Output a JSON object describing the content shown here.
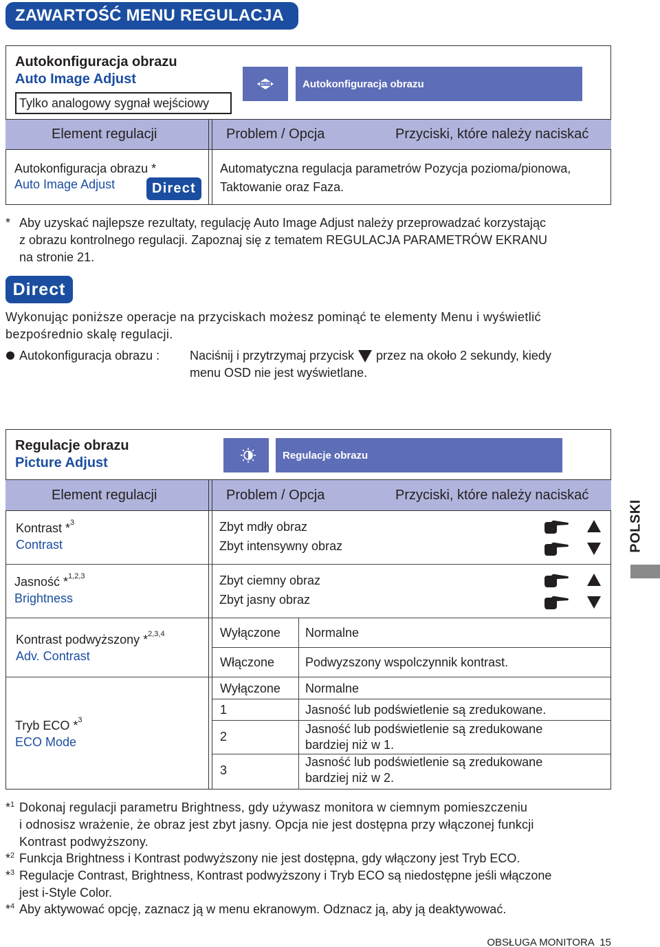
{
  "page_title": "ZAWARTOŚĆ MENU REGULACJA",
  "side_tab": "POLSKI",
  "footer": "OBSŁUGA MONITORA  15",
  "colors": {
    "brand_blue": "#1b4ea0",
    "osd_blue": "#5d6db7",
    "header_lavender": "#b0b4dc",
    "side_tab_grey": "#8a8a8a"
  },
  "auto_section": {
    "title": "Autokonfiguracja obrazu",
    "subtitle": "Auto Image Adjust",
    "note_box": "Tylko analogowy sygnał wejściowy",
    "osd_icon": "auto-adjust-icon",
    "osd_label": "Autokonfiguracja obrazu",
    "headers": {
      "element": "Element regulacji",
      "problem": "Problem / Opcja",
      "buttons": "Przyciski, które należy naciskać"
    },
    "row": {
      "name": "Autokonfiguracja obrazu *",
      "name_en": "Auto Image Adjust",
      "badge": "Direct",
      "desc_line1": "Automatyczna regulacja parametrów Pozycja pozioma/pionowa,",
      "desc_line2": "Taktowanie oraz Faza."
    },
    "footnote": {
      "marker": "*",
      "line1": "Aby uzyskać najlepsze rezultaty, regulację Auto Image Adjust należy przeprowadzać korzystając",
      "line2": "z obrazu kontrolnego regulacji. Zapoznaj się z tematem REGULACJA PARAMETRÓW EKRANU",
      "line3": "na stronie 21."
    }
  },
  "direct_section": {
    "badge": "Direct",
    "intro_line1": "Wykonując poniższe operacje na przyciskach możesz pominąć te elementy Menu i wyświetlić",
    "intro_line2": "bezpośrednio skalę regulacji.",
    "item_label": "Autokonfiguracja obrazu :",
    "item_text_before": "Naciśnij i przytrzymaj przycisk",
    "item_button_icon": "down-triangle-icon",
    "item_text_after": "przez na około 2 sekundy, kiedy",
    "item_text_line2": "menu OSD nie jest wyświetlane."
  },
  "picture_section": {
    "title": "Regulacje obrazu",
    "subtitle": "Picture Adjust",
    "osd_icon": "brightness-contrast-icon",
    "osd_label": "Regulacje obrazu",
    "headers": {
      "element": "Element regulacji",
      "problem": "Problem / Opcja",
      "buttons": "Przyciski, które należy naciskać"
    },
    "contrast": {
      "name": "Kontrast *",
      "sup": "3",
      "name_en": "Contrast",
      "problems": [
        "Zbyt mdły obraz",
        "Zbyt intensywny obraz"
      ],
      "buttons": [
        "up",
        "down"
      ]
    },
    "brightness": {
      "name": "Jasność *",
      "sup": "1,2,3",
      "name_en": "Brightness",
      "problems": [
        "Zbyt ciemny obraz",
        "Zbyt jasny obraz"
      ],
      "buttons": [
        "up",
        "down"
      ]
    },
    "adv_contrast": {
      "name": "Kontrast podwyższony *",
      "sup": "2,3,4",
      "name_en": "Adv. Contrast",
      "options": [
        {
          "option": "Wyłączone",
          "desc": "Normalne"
        },
        {
          "option": "Włączone",
          "desc": "Podwyzszony wspolczynnik kontrast."
        }
      ]
    },
    "eco_mode": {
      "name": "Tryb ECO *",
      "sup": "3",
      "name_en": "ECO Mode",
      "options": [
        {
          "option": "Wyłączone",
          "desc": "Normalne",
          "desc2": ""
        },
        {
          "option": "1",
          "desc": "Jasność lub podświetlenie są zredukowane.",
          "desc2": ""
        },
        {
          "option": "2",
          "desc": "Jasność lub podświetlenie są zredukowane",
          "desc2": "bardziej niż w 1."
        },
        {
          "option": "3",
          "desc": "Jasność lub podświetlenie są zredukowane",
          "desc2": "bardziej niż w 2."
        }
      ]
    }
  },
  "footnotes": [
    {
      "marker": "*",
      "num": "1",
      "lines": [
        "Dokonaj regulacji parametru Brightness, gdy używasz monitora w ciemnym pomieszczeniu",
        "i odnosisz wrażenie, że obraz jest zbyt jasny. Opcja nie jest dostępna przy włączonej funkcji",
        "Kontrast podwyższony."
      ]
    },
    {
      "marker": "*",
      "num": "2",
      "lines": [
        "Funkcja Brightness i Kontrast podwyższony nie jest dostępna, gdy włączony jest Tryb ECO."
      ]
    },
    {
      "marker": "*",
      "num": "3",
      "lines": [
        "Regulacje Contrast, Brightness, Kontrast podwyższony i Tryb ECO są niedostępne jeśli włączone",
        "jest i-Style Color."
      ]
    },
    {
      "marker": "*",
      "num": "4",
      "lines": [
        "Aby aktywować opcję, zaznacz ją w menu ekranowym. Odznacz ją, aby ją deaktywować."
      ]
    }
  ]
}
